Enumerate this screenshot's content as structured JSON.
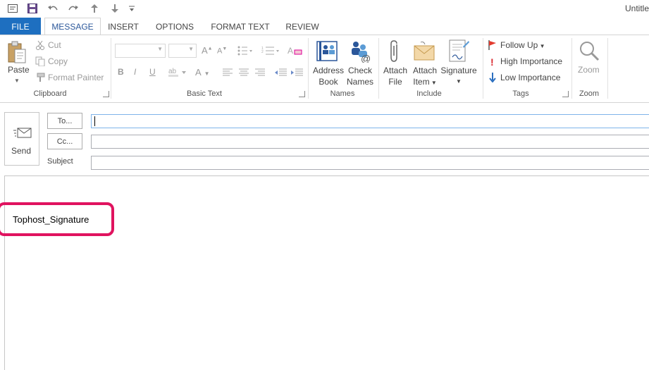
{
  "window": {
    "title": "Untitle"
  },
  "qat": {
    "icons": [
      "outlook-icon",
      "save-icon",
      "undo-icon",
      "redo-icon",
      "up-arrow-icon",
      "down-arrow-icon",
      "customize-qat-icon"
    ]
  },
  "tabs": {
    "file": "FILE",
    "message": "MESSAGE",
    "insert": "INSERT",
    "options": "OPTIONS",
    "format_text": "FORMAT TEXT",
    "review": "REVIEW"
  },
  "clipboard": {
    "paste": "Paste",
    "cut": "Cut",
    "copy": "Copy",
    "format_painter": "Format Painter",
    "label": "Clipboard"
  },
  "basic_text": {
    "label": "Basic Text",
    "bold": "B",
    "italic": "I",
    "underline": "U",
    "grow": "A",
    "shrink": "A",
    "font_color": "A"
  },
  "names": {
    "address_book_1": "Address",
    "address_book_2": "Book",
    "check_names_1": "Check",
    "check_names_2": "Names",
    "label": "Names"
  },
  "include": {
    "attach_file_1": "Attach",
    "attach_file_2": "File",
    "attach_item_1": "Attach",
    "attach_item_2": "Item",
    "signature": "Signature",
    "label": "Include"
  },
  "tags": {
    "follow_up": "Follow Up",
    "high": "High Importance",
    "low": "Low Importance",
    "label": "Tags"
  },
  "zoom": {
    "zoom": "Zoom",
    "label": "Zoom"
  },
  "compose": {
    "send": "Send",
    "to": "To...",
    "cc": "Cc...",
    "subject": "Subject",
    "to_value": "",
    "cc_value": "",
    "subject_value": ""
  },
  "body": {
    "signature_text": "Tophost_Signature"
  },
  "colors": {
    "file_tab": "#1e6fc0",
    "highlight": "#e0135f",
    "accent": "#2b579a"
  }
}
